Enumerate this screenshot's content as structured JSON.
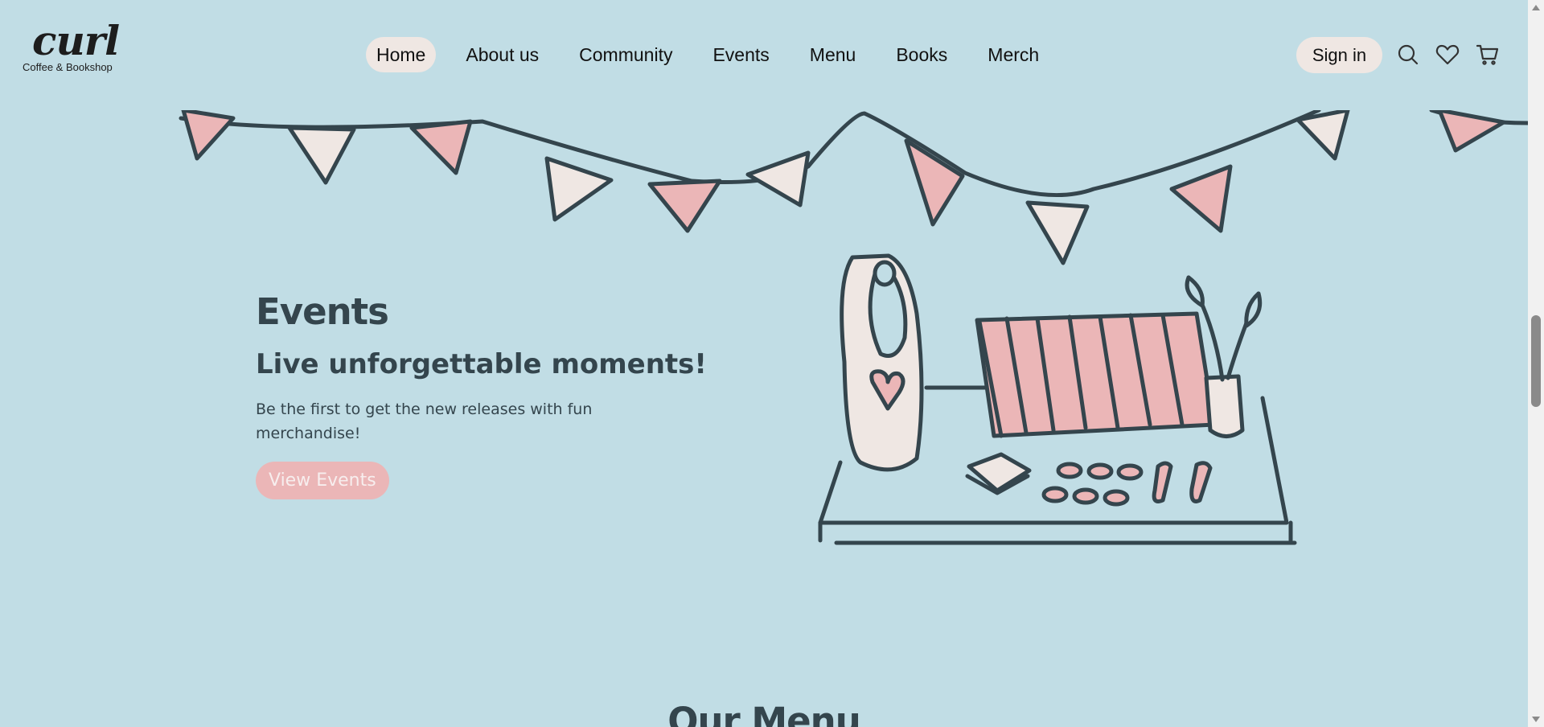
{
  "brand": {
    "logo_word": "curl",
    "tagline": "Coffee & Bookshop"
  },
  "nav": {
    "items": [
      "Home",
      "About us",
      "Community",
      "Events",
      "Menu",
      "Books",
      "Merch"
    ],
    "active": "Home"
  },
  "header": {
    "signin_label": "Sign in",
    "icons": [
      "search-icon",
      "heart-icon",
      "cart-icon"
    ]
  },
  "events": {
    "title": "Events",
    "subtitle": "Live unforgettable moments!",
    "body": "Be the first to get the new releases with fun merchandise!",
    "button_label": "View Events"
  },
  "next_section": {
    "title": "Our Menu"
  },
  "colors": {
    "background": "#c1dde5",
    "ink": "#34454d",
    "pink": "#ebb6b7",
    "cream": "#efe7e3"
  }
}
